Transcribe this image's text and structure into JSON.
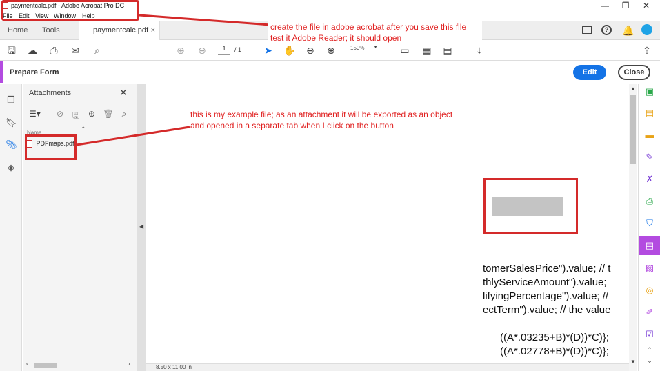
{
  "window": {
    "title": "paymentcalc.pdf - Adobe Acrobat Pro DC",
    "menu": [
      "File",
      "Edit",
      "View",
      "Window",
      "Help"
    ],
    "controls": [
      "—",
      "❐",
      "✕"
    ]
  },
  "tabs": {
    "home": "Home",
    "tools": "Tools",
    "document": "paymentcalc.pdf",
    "close": "×"
  },
  "toolbar": {
    "page_current": "1",
    "page_total": "/  1",
    "zoom": "150%"
  },
  "form_bar": {
    "title": "Prepare Form",
    "edit_label": "Edit",
    "close_label": "Close"
  },
  "attachments": {
    "title": "Attachments",
    "column_name": "Name",
    "files": [
      "PDFmaps.pdf"
    ]
  },
  "status": {
    "page_size": "8.50 x 11.00 in"
  },
  "annotations": {
    "top_note": "create the file in adobe acrobat after you save this file test it Adobe Reader; it should open",
    "middle_note": "this is my example file; as an attachment it will be exported as an object and opened in a separate tab when I click on the button"
  },
  "document": {
    "code_lines": [
      "tomerSalesPrice\").value; // t",
      "thlyServiceAmount\").value;",
      "lifyingPercentage\").value; //",
      "ectTerm\").value; // the value",
      "",
      "      ((A*.03235+B)*(D))*C)};",
      "      ((A*.02778+B)*(D))*C)};"
    ]
  },
  "colors": {
    "accent": "#1473e6",
    "form_accent": "#b34be0",
    "annotation_red": "#d42a2a"
  }
}
